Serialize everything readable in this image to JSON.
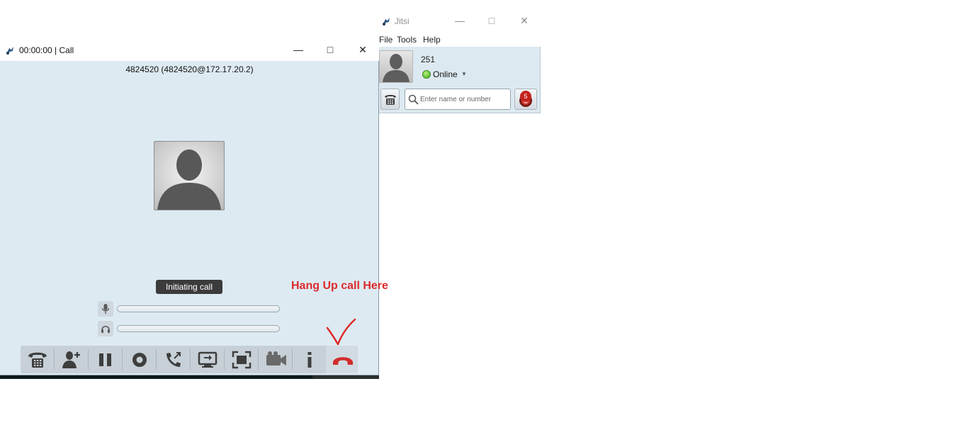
{
  "jitsi_window": {
    "title": "Jitsi",
    "menu": [
      "File",
      "Tools",
      "Help"
    ],
    "account_name": "251",
    "status": "Online",
    "search_placeholder": "Enter name or number",
    "notification_count": "5"
  },
  "call_window": {
    "title": "00:00:00 | Call",
    "peer": "4824520 (4824520@172.17.20.2)",
    "status": "Initiating call",
    "toolbar_icons": [
      "dialpad-icon",
      "add-participant-icon",
      "pause-icon",
      "record-icon",
      "transfer-call-icon",
      "desktop-share-icon",
      "fullscreen-icon",
      "video-icon",
      "info-icon",
      "hangup-icon"
    ]
  },
  "annotation": {
    "text": "Hang Up call Here",
    "color": "#dd2a2a"
  },
  "colors": {
    "panel_bg": "#ddeaf2",
    "toolbar_bg": "#c6d0d6",
    "status_online": "#3aa81b",
    "hangup_red": "#d22c2c"
  }
}
